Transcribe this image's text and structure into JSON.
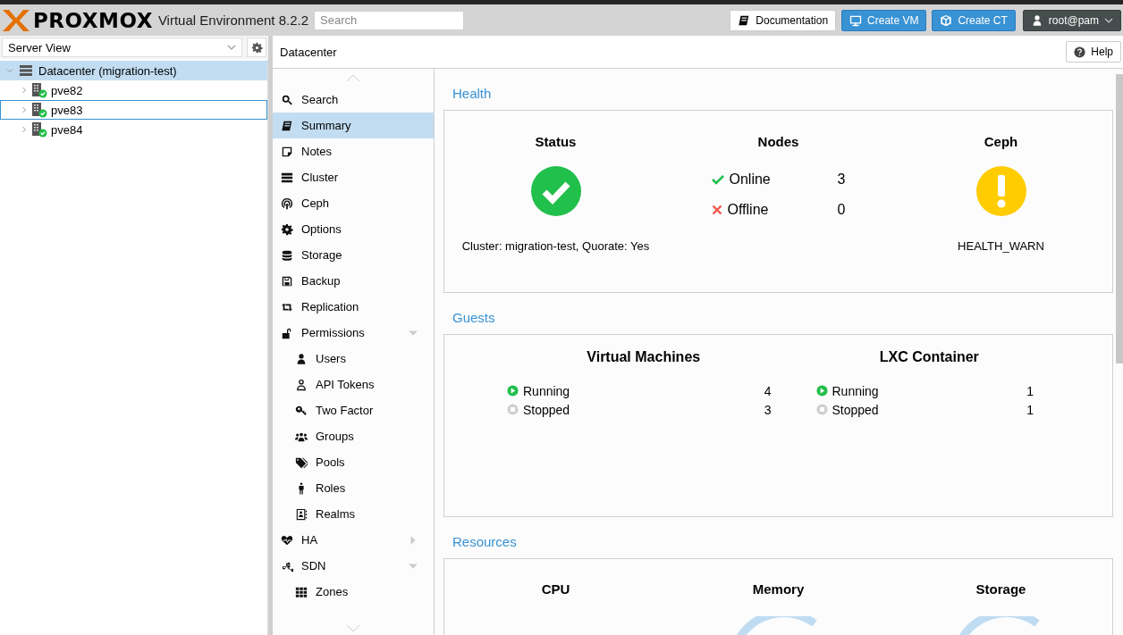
{
  "header": {
    "logo": "PROXMOX",
    "product": "Virtual Environment 8.2.2",
    "search": {
      "placeholder": "Search"
    },
    "buttons": [
      {
        "label": "Documentation",
        "kind": "plain"
      },
      {
        "label": "Create VM",
        "kind": "primary"
      },
      {
        "label": "Create CT",
        "kind": "primary"
      },
      {
        "label": "root@pam",
        "kind": "user"
      }
    ]
  },
  "sidebar": {
    "view": "Server View",
    "tree": [
      {
        "label": "Datacenter (migration-test)",
        "kind": "datacenter",
        "selected": true,
        "focused": false,
        "expanded": true,
        "children": [
          {
            "label": "pve82",
            "kind": "node",
            "selected": false,
            "focused": false,
            "expanded": false
          },
          {
            "label": "pve83",
            "kind": "node",
            "selected": false,
            "focused": true,
            "expanded": false
          },
          {
            "label": "pve84",
            "kind": "node",
            "selected": false,
            "focused": false,
            "expanded": false
          }
        ]
      }
    ]
  },
  "panel": {
    "title": "Datacenter",
    "help": "Help"
  },
  "nav": [
    {
      "label": "Search",
      "selected": false
    },
    {
      "label": "Summary",
      "selected": true
    },
    {
      "label": "Notes",
      "selected": false
    },
    {
      "label": "Cluster",
      "selected": false
    },
    {
      "label": "Ceph",
      "selected": false
    },
    {
      "label": "Options",
      "selected": false
    },
    {
      "label": "Storage",
      "selected": false
    },
    {
      "label": "Backup",
      "selected": false
    },
    {
      "label": "Replication",
      "selected": false
    },
    {
      "label": "Permissions",
      "selected": false,
      "expanded": true,
      "children": [
        {
          "label": "Users",
          "selected": false
        },
        {
          "label": "API Tokens",
          "selected": false
        },
        {
          "label": "Two Factor",
          "selected": false
        },
        {
          "label": "Groups",
          "selected": false
        },
        {
          "label": "Pools",
          "selected": false
        },
        {
          "label": "Roles",
          "selected": false
        },
        {
          "label": "Realms",
          "selected": false
        }
      ]
    },
    {
      "label": "HA",
      "selected": false,
      "expanded": false
    },
    {
      "label": "SDN",
      "selected": false,
      "expanded": true,
      "children": [
        {
          "label": "Zones",
          "selected": false
        }
      ]
    }
  ],
  "health": {
    "title": "Health",
    "status": {
      "title": "Status",
      "kind": "ok",
      "text": "Cluster: migration-test, Quorate: Yes"
    },
    "nodes": {
      "title": "Nodes",
      "rows": [
        {
          "label": "Online",
          "kind": "online",
          "count": "3"
        },
        {
          "label": "Offline",
          "kind": "offline",
          "count": "0"
        }
      ]
    },
    "ceph": {
      "title": "Ceph",
      "kind": "warn",
      "text": "HEALTH_WARN"
    }
  },
  "guests": {
    "title": "Guests",
    "groups": [
      {
        "title": "Virtual Machines",
        "rows": [
          {
            "label": "Running",
            "kind": "running",
            "count": "4"
          },
          {
            "label": "Stopped",
            "kind": "stopped",
            "count": "3"
          }
        ]
      },
      {
        "title": "LXC Container",
        "rows": [
          {
            "label": "Running",
            "kind": "running",
            "count": "1"
          },
          {
            "label": "Stopped",
            "kind": "stopped",
            "count": "1"
          }
        ]
      }
    ]
  },
  "resources": {
    "title": "Resources",
    "gauges": [
      {
        "title": "CPU",
        "shown": false
      },
      {
        "title": "Memory",
        "shown": true
      },
      {
        "title": "Storage",
        "shown": true
      }
    ]
  }
}
